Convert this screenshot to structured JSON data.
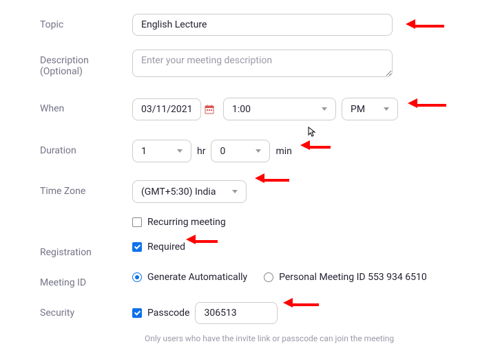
{
  "labels": {
    "topic": "Topic",
    "description": "Description (Optional)",
    "when": "When",
    "duration": "Duration",
    "timezone": "Time Zone",
    "registration": "Registration",
    "meeting_id": "Meeting ID",
    "security": "Security"
  },
  "topic": {
    "value": "English Lecture"
  },
  "description": {
    "placeholder": "Enter your meeting description",
    "value": ""
  },
  "when": {
    "date": "03/11/2021",
    "time": "1:00",
    "ampm": "PM"
  },
  "duration": {
    "hours": "1",
    "hr_label": "hr",
    "minutes": "0",
    "min_label": "min"
  },
  "timezone": {
    "value": "(GMT+5:30) India"
  },
  "recurring": {
    "checked": false,
    "label": "Recurring meeting"
  },
  "registration": {
    "checked": true,
    "label": "Required"
  },
  "meeting_id": {
    "generate": {
      "selected": true,
      "label": "Generate Automatically"
    },
    "personal": {
      "selected": false,
      "label": "Personal Meeting ID 553 934 6510"
    }
  },
  "security": {
    "passcode_checked": true,
    "passcode_label": "Passcode",
    "passcode_value": "306513",
    "hint": "Only users who have the invite link or passcode can join the meeting"
  }
}
